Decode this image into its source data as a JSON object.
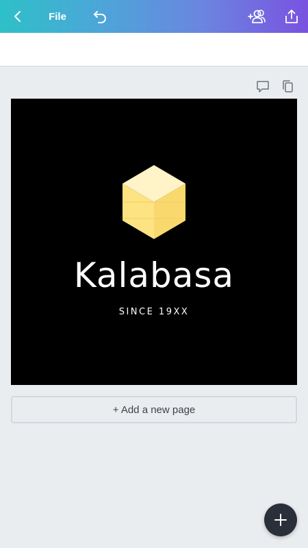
{
  "header": {
    "back_icon": "chevron-left-icon",
    "file_label": "File",
    "undo_icon": "undo-icon",
    "collaborate_icon": "add-people-icon",
    "share_icon": "share-upload-icon",
    "gradient_colors": [
      "#2ec0c8",
      "#6a86e0",
      "#7a52e0"
    ]
  },
  "page_actions": {
    "comment_icon": "comment-icon",
    "duplicate_icon": "duplicate-page-icon"
  },
  "design": {
    "background": "#000000",
    "logo_icon": "cube-icon",
    "logo_colors": [
      "#fff3c8",
      "#fde382",
      "#f8d86c"
    ],
    "brand_name": "Kalabasa",
    "tagline": "SINCE 19XX"
  },
  "add_page": {
    "label": "+ Add a new page"
  },
  "fab": {
    "icon": "plus-icon"
  }
}
